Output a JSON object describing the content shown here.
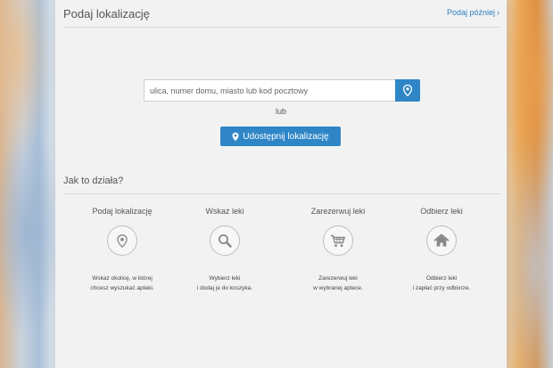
{
  "header": {
    "title": "Podaj lokalizację",
    "later_link": "Podaj później",
    "later_chevron": "›"
  },
  "search": {
    "placeholder": "ulica, numer domu, miasto lub kod pocztowy",
    "pin_icon": "map-pin-icon"
  },
  "or_text": "lub",
  "share_button": {
    "label": "Udostępnij lokalizację",
    "icon": "map-pin-icon"
  },
  "how": {
    "title": "Jak to działa?",
    "steps": [
      {
        "title": "Podaj lokalizację",
        "icon": "location-pin-icon",
        "line1": "Wskaż okolicę, w której",
        "line2": "chcesz wyszukać apteki."
      },
      {
        "title": "Wskaż leki",
        "icon": "search-icon",
        "line1": "Wybierz leki",
        "line2": "i dodaj je do koszyka."
      },
      {
        "title": "Zarezerwuj leki",
        "icon": "cart-icon",
        "line1": "Zarezerwuj leki",
        "line2": "w wybranej aptece."
      },
      {
        "title": "Odbierz leki",
        "icon": "home-icon",
        "line1": "Odbierz leki",
        "line2": "i zapłać przy odbiorze."
      }
    ]
  },
  "colors": {
    "accent": "#2f86c7",
    "panel_bg": "#f2f2f2",
    "text": "#555555"
  }
}
